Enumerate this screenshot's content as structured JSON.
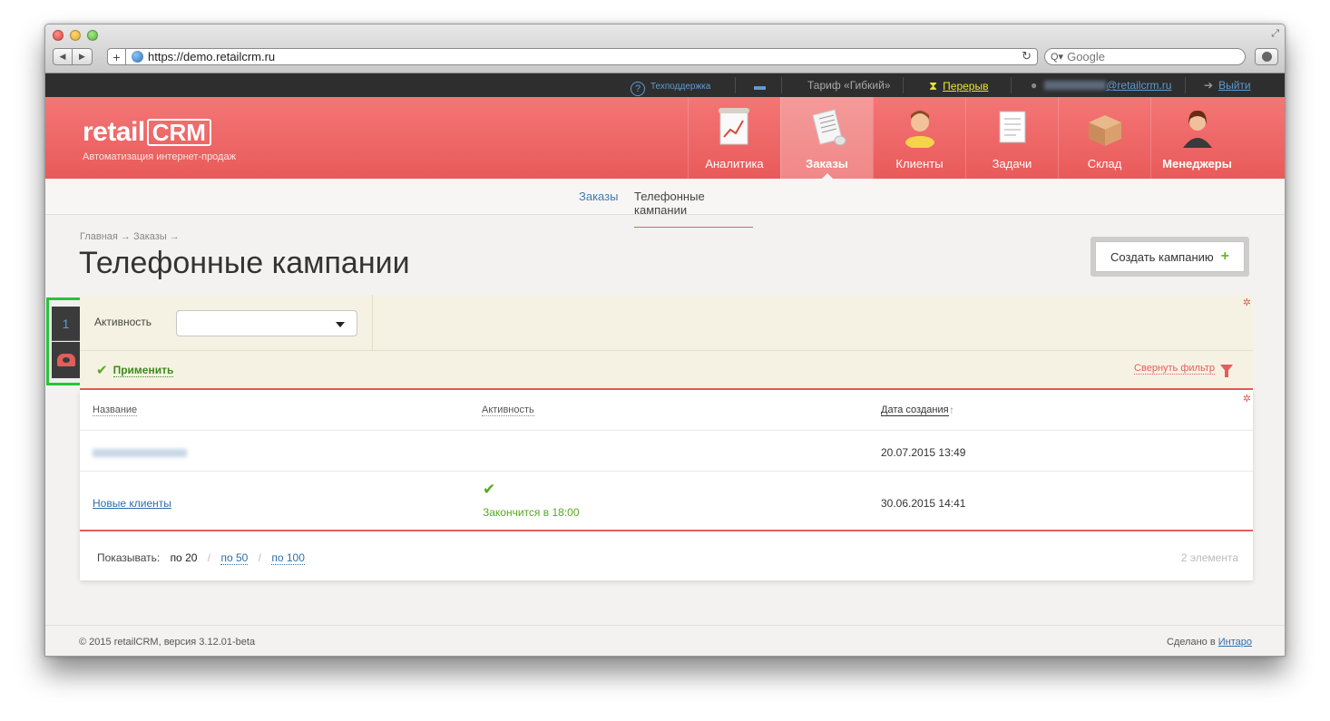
{
  "browser": {
    "url": "https://demo.retailcrm.ru",
    "search_placeholder": "Google"
  },
  "topbar": {
    "support": "Техподдержка",
    "tariff": "Тариф «Гибкий»",
    "break": "Перерыв",
    "email": "@retailcrm.ru",
    "logout": "Выйти"
  },
  "header": {
    "logo_word": "retail",
    "logo_crm": "CRM",
    "tagline": "Автоматизация интернет-продаж",
    "modules": [
      {
        "label": "Аналитика",
        "icon": "analytics-icon",
        "active": false
      },
      {
        "label": "Заказы",
        "icon": "orders-icon",
        "active": true
      },
      {
        "label": "Клиенты",
        "icon": "clients-icon",
        "active": false
      },
      {
        "label": "Задачи",
        "icon": "tasks-icon",
        "active": false
      },
      {
        "label": "Склад",
        "icon": "warehouse-icon",
        "active": false
      },
      {
        "label": "Менеджеры",
        "icon": "managers-icon",
        "active": false
      }
    ]
  },
  "subnav": {
    "orders": "Заказы",
    "phone_campaigns": "Телефонные кампании"
  },
  "breadcrumb": "Главная → Заказы →",
  "page_title": "Телефонные кампании",
  "create_button": "Создать кампанию",
  "sidetabs": {
    "tab1": "1"
  },
  "filter": {
    "activity_label": "Активность",
    "activity_value": "",
    "apply": "Применить",
    "collapse": "Свернуть фильтр"
  },
  "table": {
    "headers": {
      "name": "Название",
      "activity": "Активность",
      "created": "Дата создания"
    },
    "sort_arrow": "↑",
    "rows": [
      {
        "name": "",
        "activity": "",
        "created": "20.07.2015 13:49"
      },
      {
        "name": "Новые клиенты",
        "activity": "Закончится в 18:00",
        "created": "30.06.2015 14:41"
      }
    ]
  },
  "pager": {
    "show_label": "Показывать:",
    "current": "по 20",
    "opt50": "по 50",
    "opt100": "по 100",
    "count": "2 элемента"
  },
  "footer": {
    "copyright": "© 2015 retailCRM, версия 3.12.01-beta",
    "made_by": "Сделано в",
    "made_by_link": "Интаро"
  },
  "colors": {
    "brand_red": "#e95a5a",
    "link_blue": "#2f6ea8",
    "success_green": "#55aa22",
    "highlight_green": "#28c436"
  }
}
